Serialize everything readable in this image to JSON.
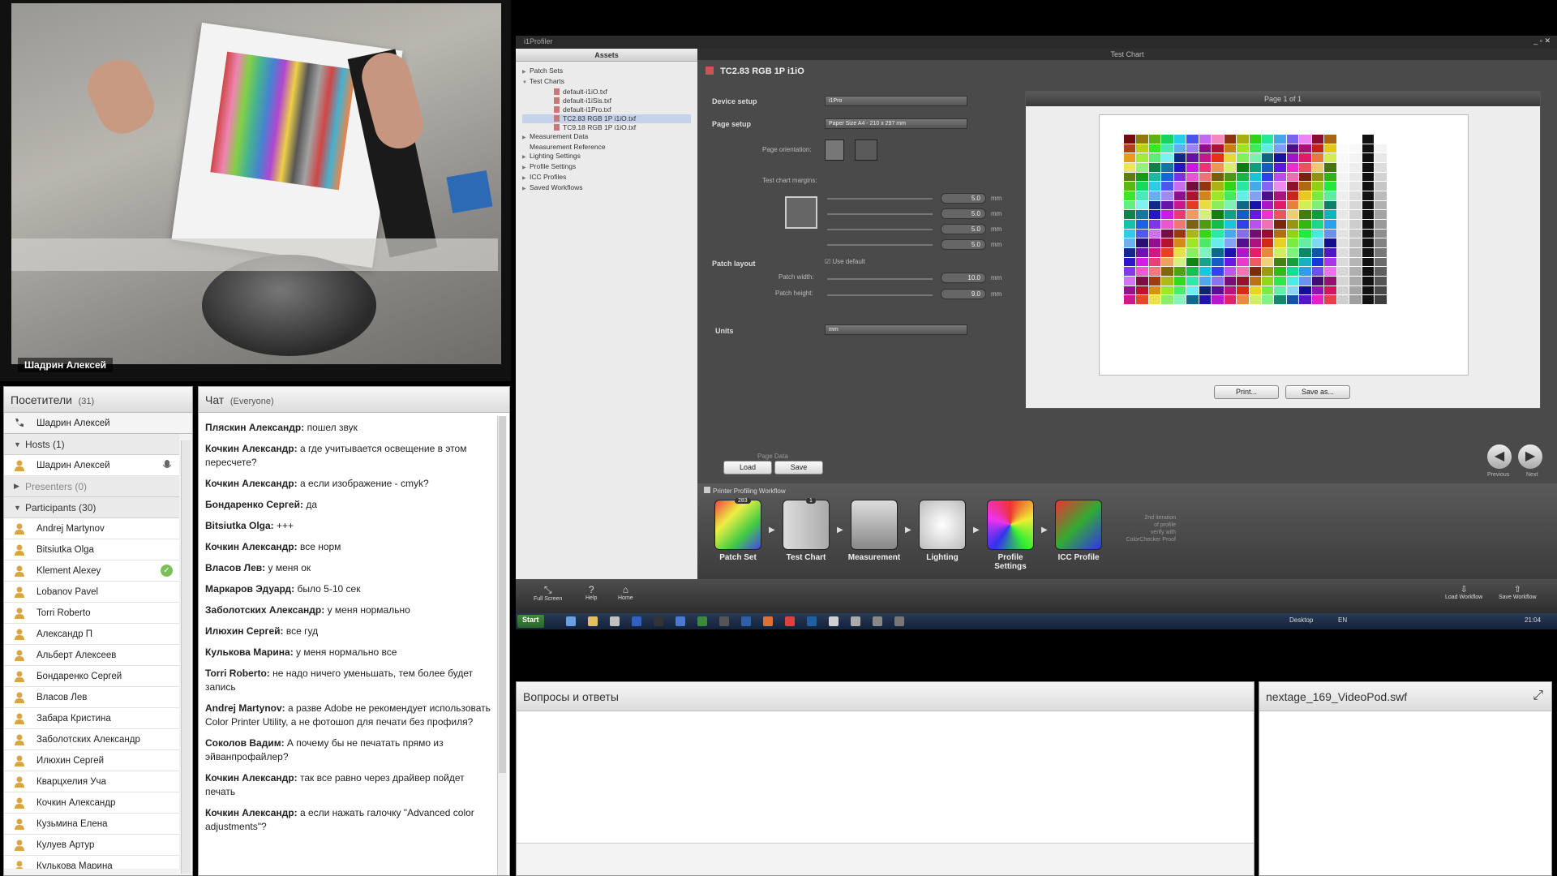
{
  "webcam": {
    "presenter_name": "Шадрин Алексей"
  },
  "attendees": {
    "title": "Посетители",
    "count": "(31)",
    "me": "Шадрин Алексей",
    "hosts_label": "Hosts (1)",
    "hosts": [
      "Шадрин Алексей"
    ],
    "presenters_label": "Presenters (0)",
    "participants_label": "Participants (30)",
    "participants": [
      "Andrej Martynov",
      "Bitsiutka Olga",
      "Klement Alexey",
      "Lobanov Pavel",
      "Torri Roberto",
      "Александр П",
      "Альберт Алексеев",
      "Бондаренко Сергей",
      "Власов Лев",
      "Забара Кристина",
      "Заболотских Александр",
      "Илюхин Сергей",
      "Кварцхелия Уча",
      "Кочкин Александр",
      "Кузьмина Елена",
      "Кулуев Артур",
      "Кулькова Марина"
    ]
  },
  "chat": {
    "title": "Чат",
    "scope": "(Everyone)",
    "messages": [
      {
        "author": "Пляскин Александр:",
        "text": " пошел звук"
      },
      {
        "author": "Кочкин Александр:",
        "text": " а где учитывается освещение в этом пересчете?"
      },
      {
        "author": "Кочкин Александр:",
        "text": " а если изображение - cmyk?"
      },
      {
        "author": "Бондаренко Сергей:",
        "text": " да"
      },
      {
        "author": "Bitsiutka Olga:",
        "text": " +++"
      },
      {
        "author": "Кочкин Александр:",
        "text": " все норм"
      },
      {
        "author": "Власов Лев:",
        "text": " у меня ок"
      },
      {
        "author": "Маркаров Эдуард:",
        "text": " было 5-10 сек"
      },
      {
        "author": "Заболотских Александр:",
        "text": " у меня нормально"
      },
      {
        "author": "Илюхин Сергей:",
        "text": " все гуд"
      },
      {
        "author": "Кулькова Марина:",
        "text": " у меня нормально все"
      },
      {
        "author": "Torri Roberto:",
        "text": " не надо ничего уменьшать, тем более будет запись"
      },
      {
        "author": "Andrej Martynov:",
        "text": " а разве Adobe не рекомендует использовать Color Printer Utility, а не фотошоп для печати без профиля?"
      },
      {
        "author": "Соколов Вадим:",
        "text": " А почему бы не печатать прямо из эйванпрофайлер?"
      },
      {
        "author": "Кочкин Александр:",
        "text": " так все равно через драйвер пойдет печать"
      },
      {
        "author": "Кочкин Александр:",
        "text": " а если нажать галочку \"Advanced color adjustments\"?"
      }
    ]
  },
  "app": {
    "window_title": "i1Profiler",
    "assets_title": "Assets",
    "tree": [
      "Patch Sets",
      "Test Charts",
      "default-i1iO.txf",
      "default-i1iSis.txf",
      "default-i1Pro.txf",
      "TC2.83 RGB 1P i1iO.txf",
      "TC9.18 RGB 1P i1iO.txf",
      "Measurement Data",
      "Measurement Reference",
      "Lighting Settings",
      "Profile Settings",
      "ICC Profiles",
      "Saved Workflows"
    ],
    "main_title": "Test Chart",
    "chart_name": "TC2.83 RGB 1P i1iO",
    "device_setup": "Device setup",
    "device_value": "i1Pro",
    "page_setup": "Page setup",
    "page_value": "Paper Size A4 - 210 x 297 mm",
    "page_orientation": "Page orientation:",
    "margins_label": "Test chart margins:",
    "margins": [
      "5.0",
      "5.0",
      "5.0",
      "5.0"
    ],
    "unit_mm": "mm",
    "patch_layout": "Patch layout",
    "use_default": "Use default",
    "patch_width_label": "Patch width:",
    "patch_width": "10.0",
    "patch_height_label": "Patch height:",
    "patch_height": "9.0",
    "units_label": "Units",
    "units_value": "mm",
    "page_indicator": "Page 1 of 1",
    "print_btn": "Print...",
    "saveas_btn": "Save as...",
    "page_data": "Page Data",
    "load_btn": "Load",
    "save_btn": "Save",
    "previous": "Previous",
    "next": "Next",
    "workflow_title": "Printer Profiling Workflow",
    "workflow_steps": [
      "Patch Set",
      "Test Chart",
      "Measurement",
      "Lighting",
      "Profile Settings",
      "ICC Profile"
    ],
    "patch_badge": "283",
    "chart_badge": "1",
    "side_note_1": "2nd iteration",
    "side_note_2": "of profile",
    "side_note_3": "verify with",
    "side_note_4": "ColorChecker Proof",
    "fullscreen": "Full Screen",
    "help": "Help",
    "home": "Home",
    "load_workflow": "Load Workflow",
    "save_workflow": "Save Workflow",
    "taskbar_start": "Start",
    "taskbar_desktop": "Desktop",
    "taskbar_lang": "EN",
    "taskbar_time": "21:04"
  },
  "qa": {
    "title": "Вопросы и ответы"
  },
  "video": {
    "title": "nextage_169_VideoPod.swf"
  }
}
